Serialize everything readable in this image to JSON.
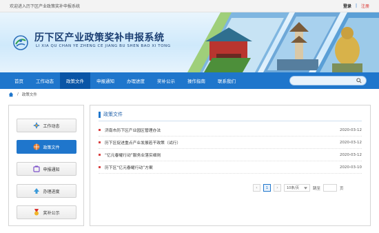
{
  "topbar": {
    "welcome": "欢迎进入历下区产业政策奖补申报系统",
    "login": "登录",
    "separator": "|",
    "register": "注册"
  },
  "banner": {
    "title": "历下区产业政策奖补申报系统",
    "subtitle": "LI XIA QU CHAN YE ZHENG CE JIANG BU SHEN BAO XI TONG"
  },
  "nav": {
    "items": [
      "首页",
      "工作动态",
      "政策文件",
      "申报通知",
      "办理进度",
      "奖补公示",
      "操作指南",
      "联系我们"
    ],
    "active_index": 2
  },
  "breadcrumb": {
    "current": "政策文件",
    "separator": "/"
  },
  "sidebar": {
    "items": [
      "工作动态",
      "政策文件",
      "申报通知",
      "办理进度",
      "奖补公示"
    ],
    "active_index": 1
  },
  "content": {
    "heading": "政策文件",
    "rows": [
      {
        "title": "济南市历下区产业园区管理办法",
        "date": "2020-03-12"
      },
      {
        "title": "历下区促进重点产业发展若干政策（试行）",
        "date": "2020-03-12"
      },
      {
        "title": "“亿元春耀行动”服务业落实细则",
        "date": "2020-03-12"
      },
      {
        "title": "历下区“亿元春耀行动”方案",
        "date": "2020-03-10"
      }
    ],
    "pager": {
      "prev": "‹",
      "current_page": "1",
      "next": "›",
      "page_size": "10条/页",
      "goto_label": "跳至",
      "page_unit": "页"
    }
  },
  "colors": {
    "primary": "#1f76cc",
    "nav_active": "#0a55a6",
    "register": "#d9302c"
  }
}
